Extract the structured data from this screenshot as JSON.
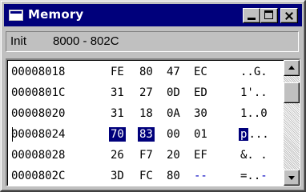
{
  "window": {
    "title": "Memory",
    "icon": "memory-window-icon",
    "title_bar_color": "#00007b",
    "controls": [
      "minimize-icon",
      "maximize-icon",
      "close-icon"
    ]
  },
  "address_bar": {
    "mode": "Init",
    "range": "8000 - 802C"
  },
  "memory": {
    "rows": [
      {
        "address": "00008018",
        "bytes": [
          "FE",
          "80",
          "47",
          "EC"
        ],
        "ascii": "..G."
      },
      {
        "address": "0000801C",
        "bytes": [
          "31",
          "27",
          "0D",
          "ED"
        ],
        "ascii": "1'.."
      },
      {
        "address": "00008020",
        "bytes": [
          "31",
          "18",
          "0A",
          "30"
        ],
        "ascii": "1..0"
      },
      {
        "address": "00008024",
        "bytes": [
          "70",
          "83",
          "00",
          "01"
        ],
        "ascii": "p..."
      },
      {
        "address": "00008028",
        "bytes": [
          "26",
          "F7",
          "20",
          "EF"
        ],
        "ascii": "&. ."
      },
      {
        "address": "0000802C",
        "bytes": [
          "3D",
          "FC",
          "80",
          "--"
        ],
        "ascii": "=..-"
      }
    ],
    "selection": {
      "row": 3,
      "bytes": [
        0,
        1
      ],
      "ascii_chars": [
        0
      ]
    },
    "selection_color": "#00007b",
    "unknown_color": "#0000c0"
  }
}
